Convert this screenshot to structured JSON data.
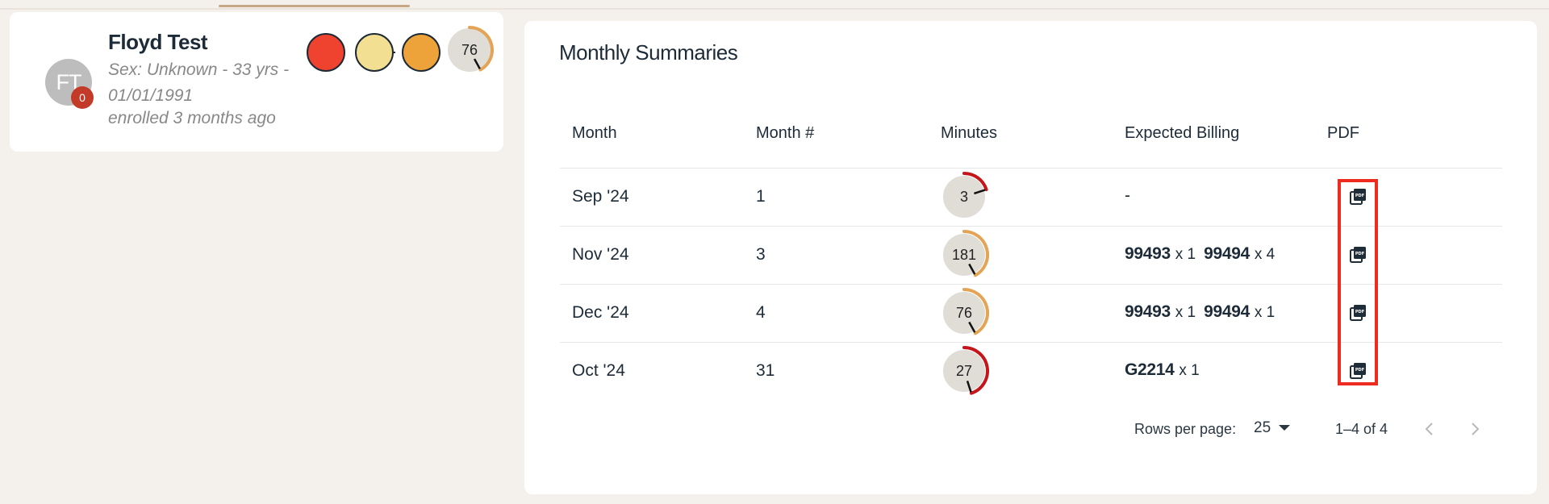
{
  "patient": {
    "initials": "FT",
    "badge_count": "0",
    "name": "Floyd Test",
    "meta": "Sex: Unknown - 33 yrs - 01/01/1991",
    "enrolled": "enrolled 3 months ago",
    "status_colors": [
      "#f0432f",
      "#f3df92",
      "#eea33a"
    ],
    "score": {
      "value": "76",
      "fraction": 0.42,
      "color": "#e3a455"
    }
  },
  "summary": {
    "title": "Monthly Summaries",
    "columns": [
      "Month",
      "Month #",
      "Minutes",
      "Expected Billing",
      "PDF"
    ],
    "rows": [
      {
        "month": "Sep '24",
        "month_num": "1",
        "minutes": "3",
        "minutes_fraction": 0.2,
        "minutes_color": "#c4161b",
        "billing": "-",
        "billing_items": [],
        "pdf_icon": "pdf-icon"
      },
      {
        "month": "Nov '24",
        "month_num": "3",
        "minutes": "181",
        "minutes_fraction": 0.42,
        "minutes_color": "#e3a455",
        "billing": "",
        "billing_items": [
          {
            "code": "99493",
            "qty": "x 1"
          },
          {
            "code": "99494",
            "qty": "x 4"
          }
        ],
        "pdf_icon": "pdf-icon"
      },
      {
        "month": "Dec '24",
        "month_num": "4",
        "minutes": "76",
        "minutes_fraction": 0.42,
        "minutes_color": "#e3a455",
        "billing": "",
        "billing_items": [
          {
            "code": "99493",
            "qty": "x 1"
          },
          {
            "code": "99494",
            "qty": "x 1"
          }
        ],
        "pdf_icon": "pdf-icon"
      },
      {
        "month": "Oct '24",
        "month_num": "31",
        "minutes": "27",
        "minutes_fraction": 0.45,
        "minutes_color": "#c4161b",
        "billing": "",
        "billing_items": [
          {
            "code": "G2214",
            "qty": "x 1"
          }
        ],
        "pdf_icon": "pdf-icon"
      }
    ],
    "pagination": {
      "rows_per_page_label": "Rows per page:",
      "rows_per_page_value": "25",
      "range": "1–4 of 4",
      "prev_icon": "chevron-left-icon",
      "next_icon": "chevron-right-icon"
    }
  },
  "highlight_color": "#ee2b1f"
}
